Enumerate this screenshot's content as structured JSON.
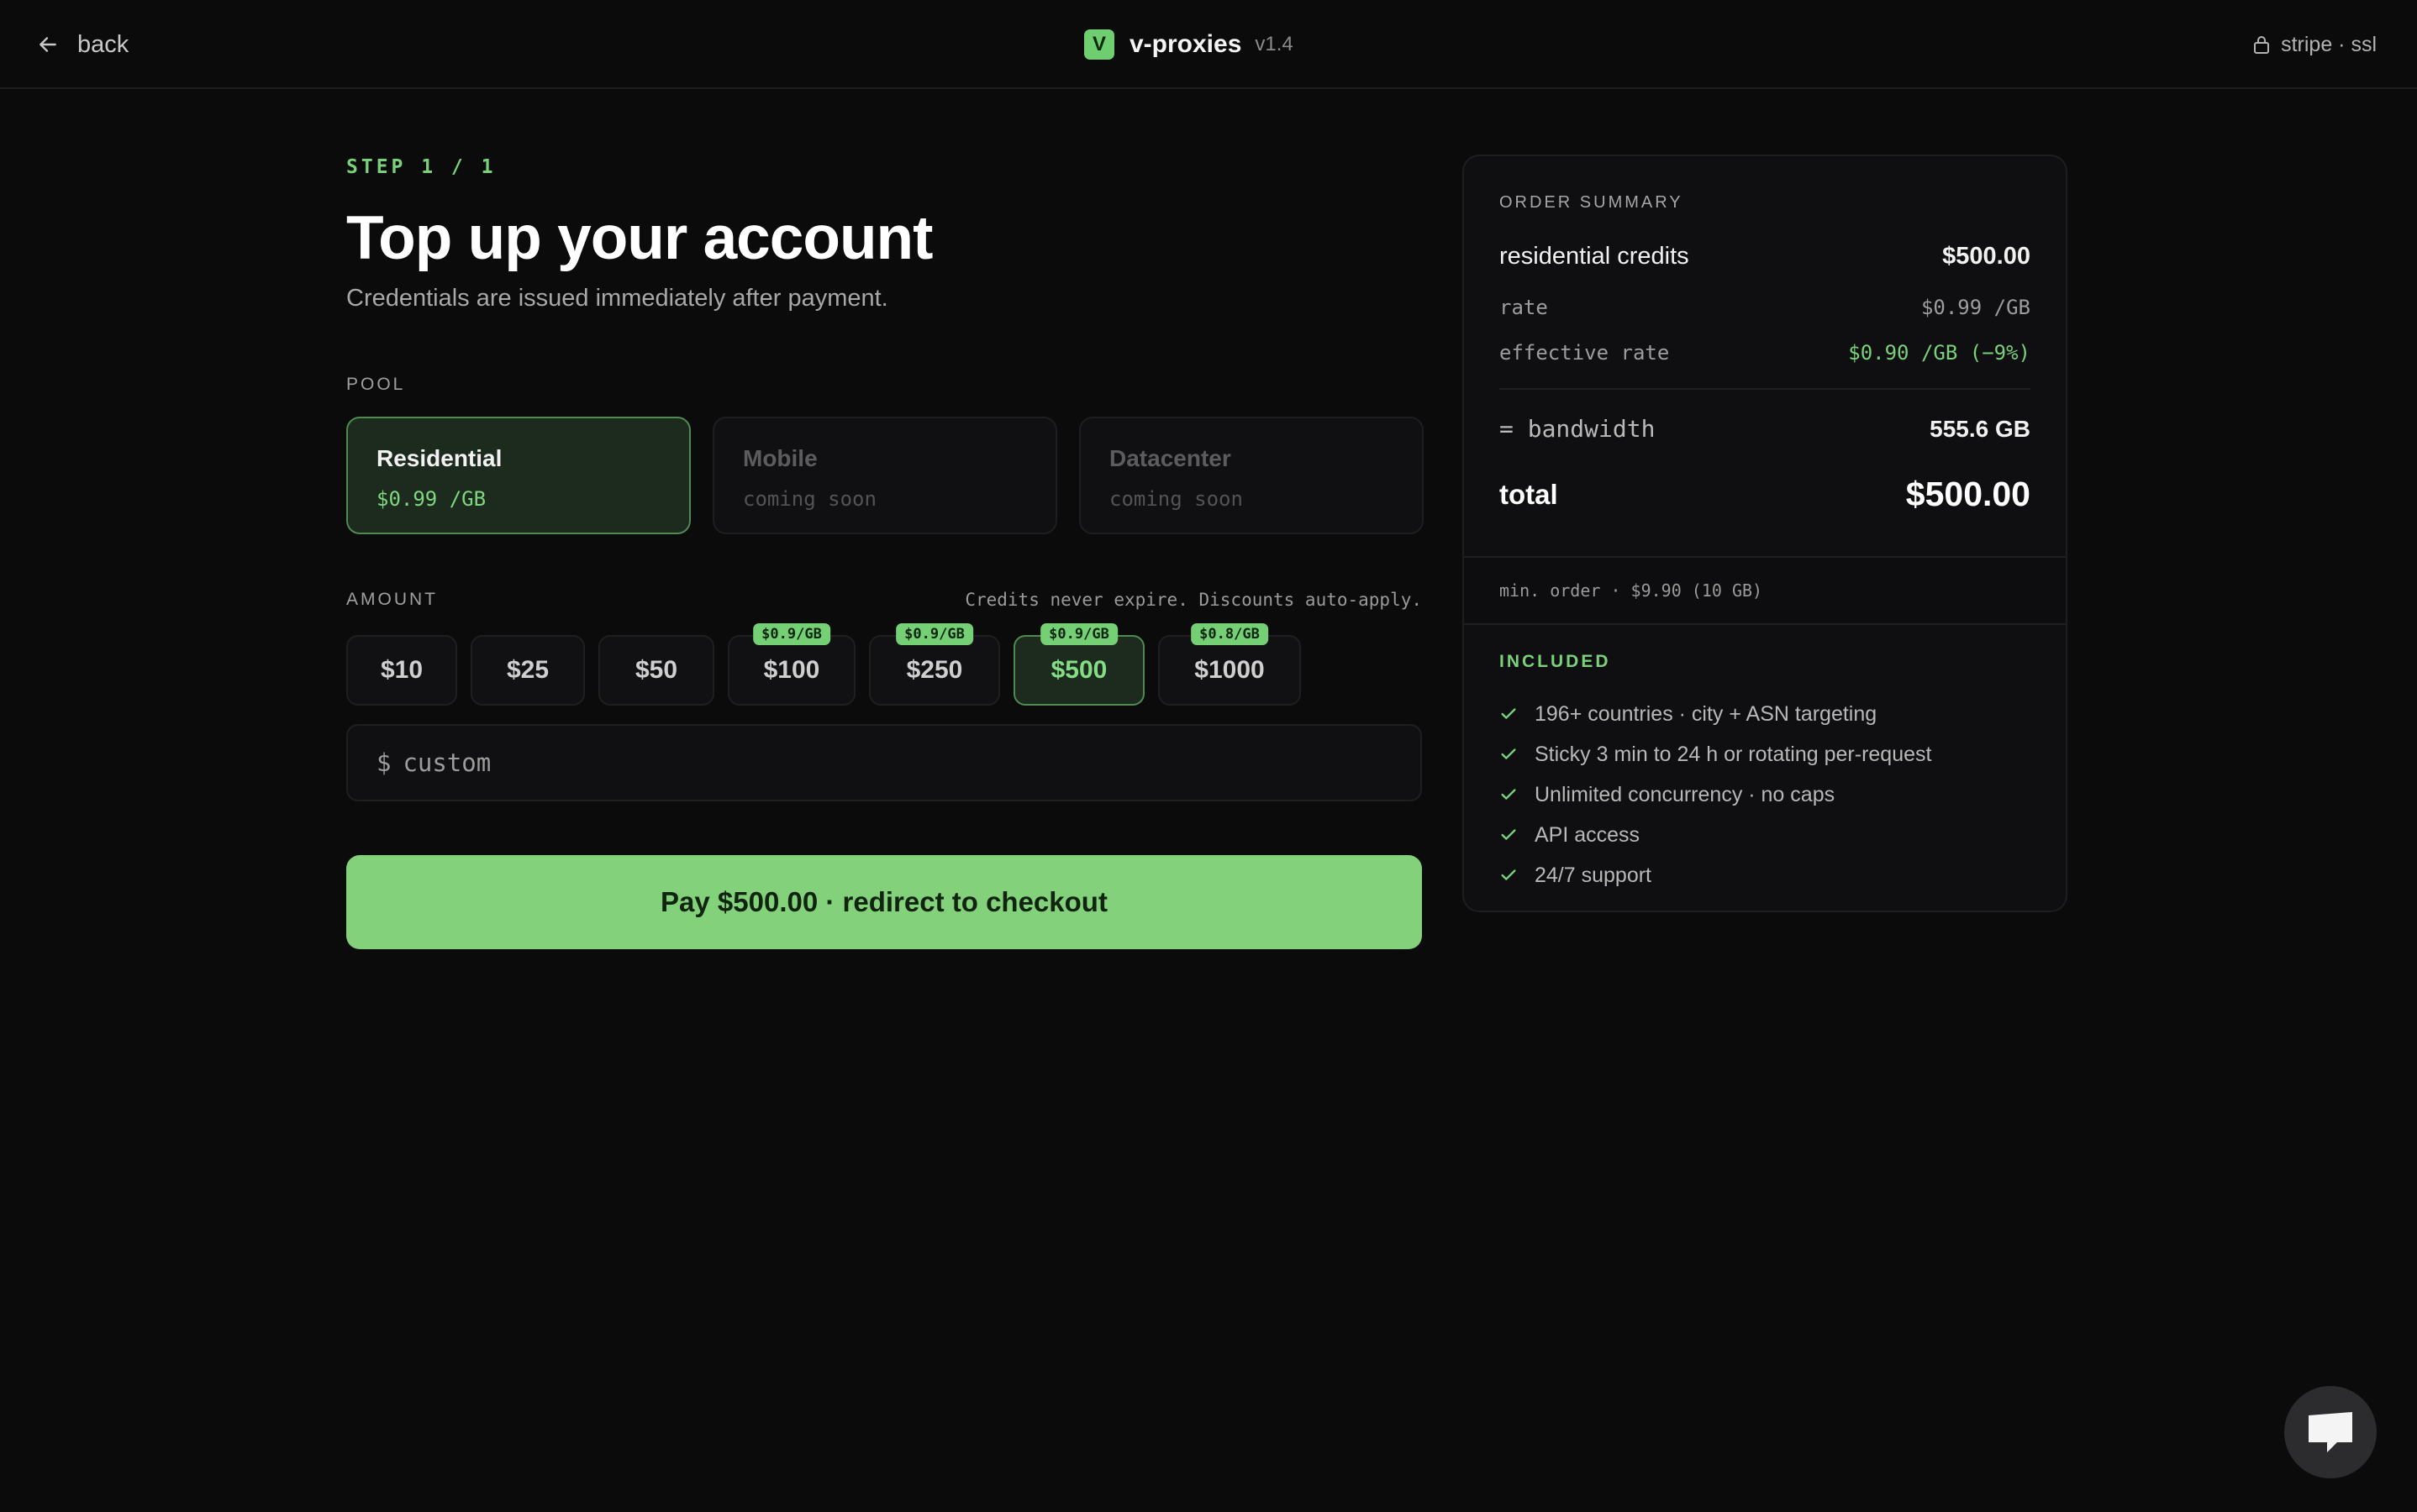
{
  "header": {
    "back_label": "back",
    "logo_letter": "V",
    "brand": "v-proxies",
    "version": "v1.4",
    "secure_label": "stripe · ssl"
  },
  "checkout": {
    "step": "STEP 1 / 1",
    "title": "Top up your account",
    "subtitle": "Credentials are issued immediately after payment.",
    "pool_label": "POOL",
    "pools": [
      {
        "name": "Residential",
        "sub": "$0.99 /GB",
        "selected": true,
        "enabled": true
      },
      {
        "name": "Mobile",
        "sub": "coming soon",
        "selected": false,
        "enabled": false
      },
      {
        "name": "Datacenter",
        "sub": "coming soon",
        "selected": false,
        "enabled": false
      }
    ],
    "amount_label": "AMOUNT",
    "amount_note": "Credits never expire. Discounts auto-apply.",
    "amounts": [
      {
        "label": "$10",
        "badge": ""
      },
      {
        "label": "$25",
        "badge": ""
      },
      {
        "label": "$50",
        "badge": ""
      },
      {
        "label": "$100",
        "badge": "$0.9/GB"
      },
      {
        "label": "$250",
        "badge": "$0.9/GB"
      },
      {
        "label": "$500",
        "badge": "$0.9/GB",
        "selected": true
      },
      {
        "label": "$1000",
        "badge": "$0.8/GB"
      }
    ],
    "custom": {
      "prefix": "$",
      "placeholder": "custom",
      "value": ""
    },
    "pay_label": "Pay $500.00 · redirect to checkout"
  },
  "summary": {
    "title": "ORDER SUMMARY",
    "item_label": "residential credits",
    "item_value": "$500.00",
    "rate_label": "rate",
    "rate_value": "$0.99 /GB",
    "effective_label": "effective rate",
    "effective_value": "$0.90 /GB (−9%)",
    "bandwidth_label": "= bandwidth",
    "bandwidth_value": "555.6 GB",
    "total_label": "total",
    "total_value": "$500.00",
    "min_order": "min. order · $9.90 (10 GB)",
    "included_title": "INCLUDED",
    "included": [
      "196+ countries · city + ASN targeting",
      "Sticky 3 min to 24 h or rotating per-request",
      "Unlimited concurrency · no caps",
      "API access",
      "24/7 support"
    ]
  },
  "colors": {
    "accent": "#79d27a",
    "background": "#0b0b0c",
    "button": "#84d17b"
  },
  "icons": {
    "back": "arrow-left-icon",
    "secure": "lock-icon",
    "check": "check-icon",
    "chat": "chat-icon"
  }
}
